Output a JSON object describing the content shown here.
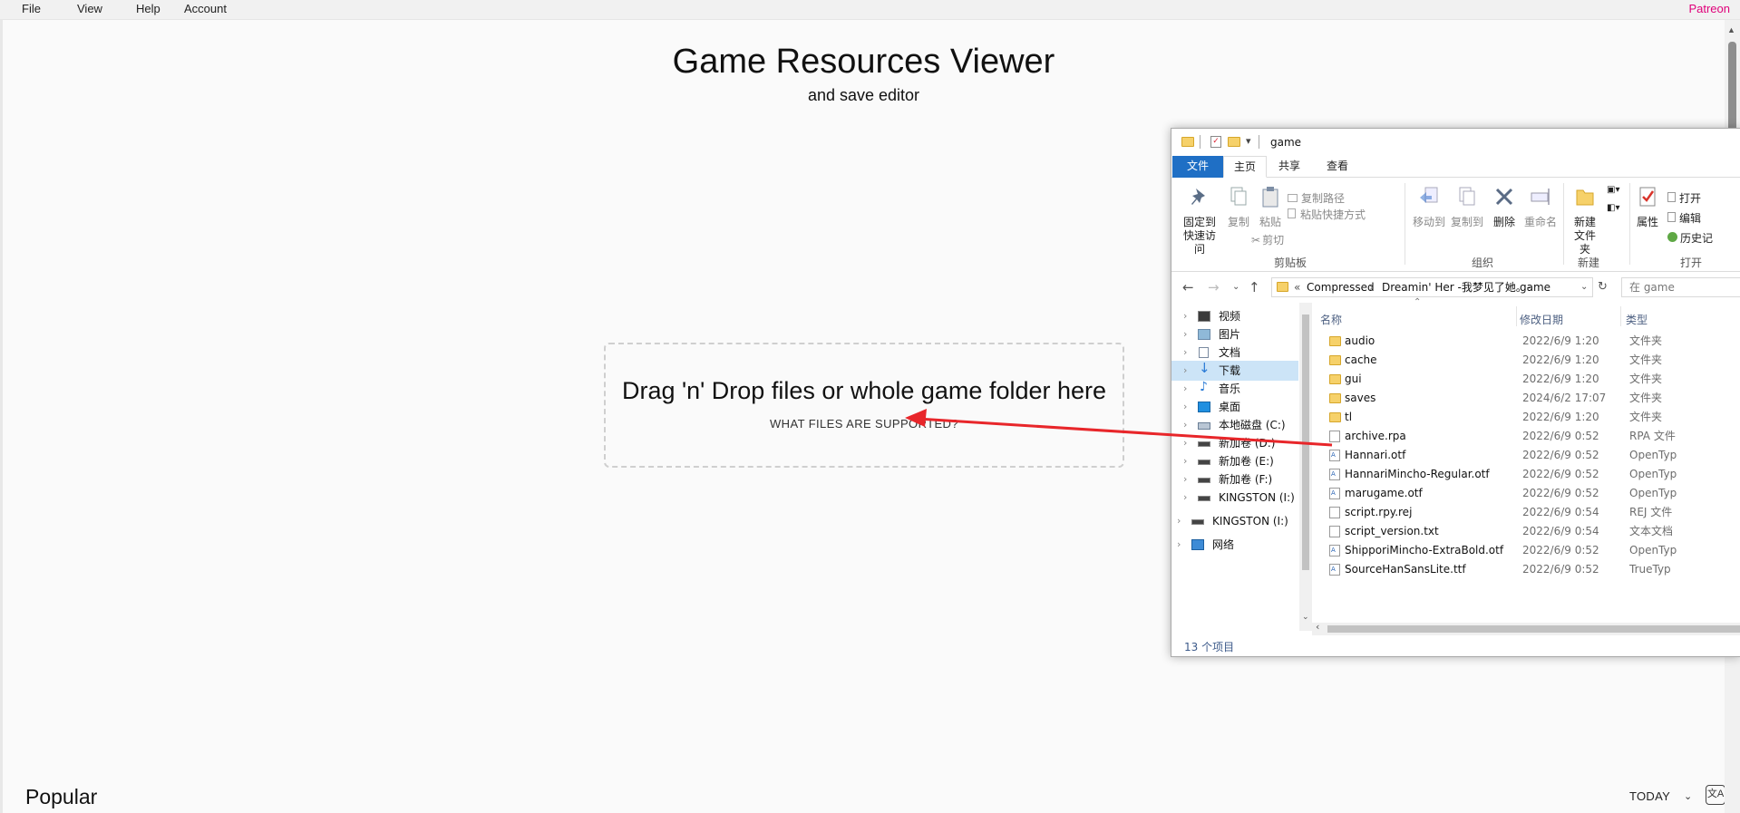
{
  "menu": {
    "items": [
      "File",
      "View",
      "Help",
      "Account"
    ],
    "patreon": "Patreon"
  },
  "hero": {
    "title": "Game Resources Viewer",
    "subtitle": "and save editor"
  },
  "dropzone": {
    "text": "Drag 'n' Drop files or whole game folder here",
    "link": "WHAT FILES ARE SUPPORTED?"
  },
  "popular": {
    "heading": "Popular",
    "period": "TODAY"
  },
  "explorer": {
    "title": "game",
    "tabs": [
      "文件",
      "主页",
      "共享",
      "查看"
    ],
    "ribbon": {
      "pin": "固定到快速访问",
      "copy": "复制",
      "paste": "粘贴",
      "copy_path": "复制路径",
      "paste_shortcut": "粘贴快捷方式",
      "cut": "剪切",
      "clipboard_group": "剪贴板",
      "move_to": "移动到",
      "copy_to": "复制到",
      "delete": "删除",
      "rename": "重命名",
      "organize_group": "组织",
      "new_folder": "新建文件夹",
      "new_group": "新建",
      "properties": "属性",
      "open": "打开",
      "edit": "编辑",
      "history": "历史记",
      "open_group": "打开"
    },
    "address": {
      "prefix": "«",
      "crumbs": [
        "Compressed",
        "Dreamin' Her -我梦见了她。-",
        "game"
      ],
      "search_placeholder": "在 game"
    },
    "nav": [
      {
        "label": "视频",
        "icon": "video-icon"
      },
      {
        "label": "图片",
        "icon": "pictures-icon"
      },
      {
        "label": "文档",
        "icon": "documents-icon"
      },
      {
        "label": "下载",
        "icon": "download-icon",
        "selected": true
      },
      {
        "label": "音乐",
        "icon": "music-icon"
      },
      {
        "label": "桌面",
        "icon": "desktop-icon"
      },
      {
        "label": "本地磁盘 (C:)",
        "icon": "drive-icon"
      },
      {
        "label": "新加卷 (D:)",
        "icon": "drive-icon"
      },
      {
        "label": "新加卷 (E:)",
        "icon": "drive-icon"
      },
      {
        "label": "新加卷 (F:)",
        "icon": "drive-icon"
      },
      {
        "label": "KINGSTON (I:)",
        "icon": "usb-drive-icon"
      },
      {
        "label": "KINGSTON (I:)",
        "icon": "usb-drive-icon"
      },
      {
        "label": "网络",
        "icon": "network-icon"
      }
    ],
    "columns": [
      "名称",
      "修改日期",
      "类型"
    ],
    "files": [
      {
        "name": "audio",
        "date": "2022/6/9 1:20",
        "type": "文件夹",
        "kind": "folder"
      },
      {
        "name": "cache",
        "date": "2022/6/9 1:20",
        "type": "文件夹",
        "kind": "folder"
      },
      {
        "name": "gui",
        "date": "2022/6/9 1:20",
        "type": "文件夹",
        "kind": "folder"
      },
      {
        "name": "saves",
        "date": "2024/6/2 17:07",
        "type": "文件夹",
        "kind": "folder"
      },
      {
        "name": "tl",
        "date": "2022/6/9 1:20",
        "type": "文件夹",
        "kind": "folder"
      },
      {
        "name": "archive.rpa",
        "date": "2022/6/9 0:52",
        "type": "RPA 文件",
        "kind": "doc"
      },
      {
        "name": "Hannari.otf",
        "date": "2022/6/9 0:52",
        "type": "OpenTyp",
        "kind": "font"
      },
      {
        "name": "HannariMincho-Regular.otf",
        "date": "2022/6/9 0:52",
        "type": "OpenTyp",
        "kind": "font"
      },
      {
        "name": "marugame.otf",
        "date": "2022/6/9 0:52",
        "type": "OpenTyp",
        "kind": "font"
      },
      {
        "name": "script.rpy.rej",
        "date": "2022/6/9 0:54",
        "type": "REJ 文件",
        "kind": "doc"
      },
      {
        "name": "script_version.txt",
        "date": "2022/6/9 0:54",
        "type": "文本文档",
        "kind": "doc"
      },
      {
        "name": "ShipporiMincho-ExtraBold.otf",
        "date": "2022/6/9 0:52",
        "type": "OpenTyp",
        "kind": "font"
      },
      {
        "name": "SourceHanSansLite.ttf",
        "date": "2022/6/9 0:52",
        "type": "TrueTyp",
        "kind": "font"
      }
    ],
    "status": "13 个项目"
  },
  "colors": {
    "accent_patreon": "#e0007a",
    "arrow": "#e8262a",
    "file_tab": "#1f6fc5",
    "nav_selected": "#cce4f7",
    "folder": "#f6d16a"
  }
}
